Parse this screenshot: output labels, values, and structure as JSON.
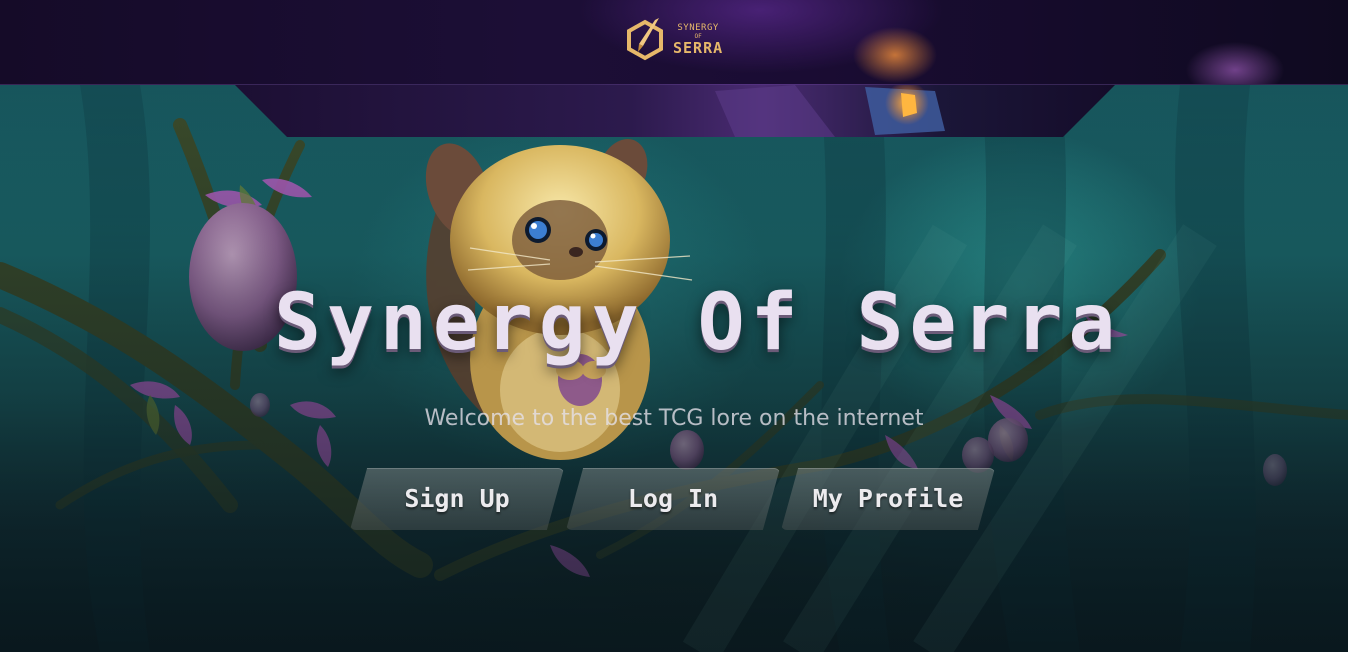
{
  "header": {
    "logo": {
      "line1": "SYNERGY",
      "line2": "OF",
      "line3": "SERRA",
      "icon": "hexagon-blade-logo-icon"
    }
  },
  "hero": {
    "title": "Synergy Of Serra",
    "subtitle": "Welcome to the best TCG lore on the internet",
    "buttons": {
      "signup": "Sign Up",
      "login": "Log In",
      "profile": "My Profile"
    }
  },
  "colors": {
    "header_bg": "#1a0c33",
    "logo_gold": "#e6b86a",
    "title_text": "#e9e0f0",
    "forest_teal": "#1b6a6e"
  }
}
